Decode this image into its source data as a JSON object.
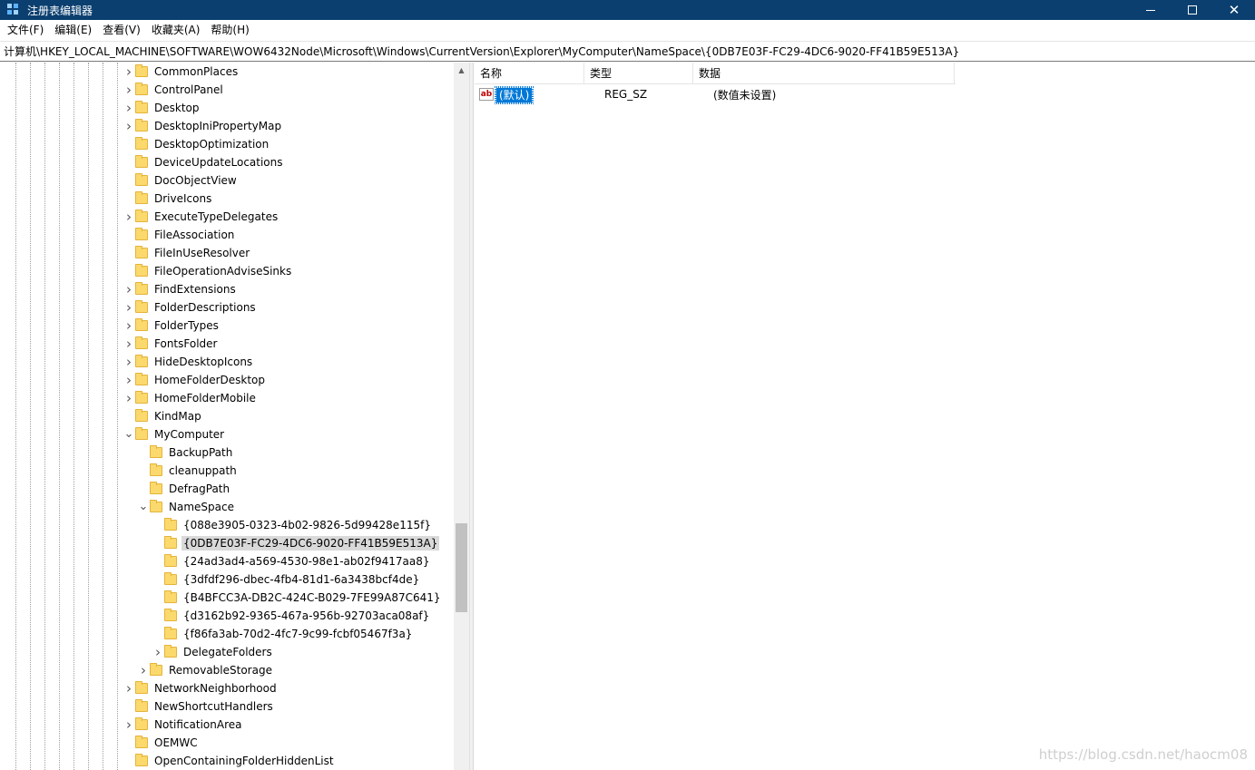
{
  "window": {
    "title": "注册表编辑器",
    "controls": {
      "minimize": "",
      "maximize": "",
      "close": "✕"
    }
  },
  "menu": [
    "文件(F)",
    "编辑(E)",
    "查看(V)",
    "收藏夹(A)",
    "帮助(H)"
  ],
  "address": "计算机\\HKEY_LOCAL_MACHINE\\SOFTWARE\\WOW6432Node\\Microsoft\\Windows\\CurrentVersion\\Explorer\\MyComputer\\NameSpace\\{0DB7E03F-FC29-4DC6-9020-FF41B59E513A}",
  "tree": [
    {
      "label": "CommonPlaces",
      "depth": 0,
      "expander": "collapsed"
    },
    {
      "label": "ControlPanel",
      "depth": 0,
      "expander": "collapsed"
    },
    {
      "label": "Desktop",
      "depth": 0,
      "expander": "collapsed"
    },
    {
      "label": "DesktopIniPropertyMap",
      "depth": 0,
      "expander": "collapsed"
    },
    {
      "label": "DesktopOptimization",
      "depth": 0,
      "expander": "none"
    },
    {
      "label": "DeviceUpdateLocations",
      "depth": 0,
      "expander": "none"
    },
    {
      "label": "DocObjectView",
      "depth": 0,
      "expander": "none"
    },
    {
      "label": "DriveIcons",
      "depth": 0,
      "expander": "none"
    },
    {
      "label": "ExecuteTypeDelegates",
      "depth": 0,
      "expander": "collapsed"
    },
    {
      "label": "FileAssociation",
      "depth": 0,
      "expander": "none"
    },
    {
      "label": "FileInUseResolver",
      "depth": 0,
      "expander": "none"
    },
    {
      "label": "FileOperationAdviseSinks",
      "depth": 0,
      "expander": "none"
    },
    {
      "label": "FindExtensions",
      "depth": 0,
      "expander": "collapsed"
    },
    {
      "label": "FolderDescriptions",
      "depth": 0,
      "expander": "collapsed"
    },
    {
      "label": "FolderTypes",
      "depth": 0,
      "expander": "collapsed"
    },
    {
      "label": "FontsFolder",
      "depth": 0,
      "expander": "collapsed"
    },
    {
      "label": "HideDesktopIcons",
      "depth": 0,
      "expander": "collapsed"
    },
    {
      "label": "HomeFolderDesktop",
      "depth": 0,
      "expander": "collapsed"
    },
    {
      "label": "HomeFolderMobile",
      "depth": 0,
      "expander": "collapsed"
    },
    {
      "label": "KindMap",
      "depth": 0,
      "expander": "none"
    },
    {
      "label": "MyComputer",
      "depth": 0,
      "expander": "expanded"
    },
    {
      "label": "BackupPath",
      "depth": 1,
      "expander": "none"
    },
    {
      "label": "cleanuppath",
      "depth": 1,
      "expander": "none"
    },
    {
      "label": "DefragPath",
      "depth": 1,
      "expander": "none"
    },
    {
      "label": "NameSpace",
      "depth": 1,
      "expander": "expanded"
    },
    {
      "label": "{088e3905-0323-4b02-9826-5d99428e115f}",
      "depth": 2,
      "expander": "none"
    },
    {
      "label": "{0DB7E03F-FC29-4DC6-9020-FF41B59E513A}",
      "depth": 2,
      "expander": "none",
      "selected": true
    },
    {
      "label": "{24ad3ad4-a569-4530-98e1-ab02f9417aa8}",
      "depth": 2,
      "expander": "none"
    },
    {
      "label": "{3dfdf296-dbec-4fb4-81d1-6a3438bcf4de}",
      "depth": 2,
      "expander": "none"
    },
    {
      "label": "{B4BFCC3A-DB2C-424C-B029-7FE99A87C641}",
      "depth": 2,
      "expander": "none"
    },
    {
      "label": "{d3162b92-9365-467a-956b-92703aca08af}",
      "depth": 2,
      "expander": "none"
    },
    {
      "label": "{f86fa3ab-70d2-4fc7-9c99-fcbf05467f3a}",
      "depth": 2,
      "expander": "none"
    },
    {
      "label": "DelegateFolders",
      "depth": 2,
      "expander": "collapsed"
    },
    {
      "label": "RemovableStorage",
      "depth": 1,
      "expander": "collapsed"
    },
    {
      "label": "NetworkNeighborhood",
      "depth": 0,
      "expander": "collapsed"
    },
    {
      "label": "NewShortcutHandlers",
      "depth": 0,
      "expander": "none"
    },
    {
      "label": "NotificationArea",
      "depth": 0,
      "expander": "collapsed"
    },
    {
      "label": "OEMWC",
      "depth": 0,
      "expander": "none"
    },
    {
      "label": "OpenContainingFolderHiddenList",
      "depth": 0,
      "expander": "none"
    }
  ],
  "values": {
    "columns": {
      "name": "名称",
      "type": "类型",
      "data": "数据"
    },
    "rows": [
      {
        "icon": "ab",
        "name": "(默认)",
        "type": "REG_SZ",
        "data": "(数值未设置)"
      }
    ]
  },
  "watermark": "https://blog.csdn.net/haocm08",
  "icons": {
    "app": "registry-editor-icon",
    "folder": "folder-icon",
    "string_value": "string-value-icon"
  },
  "colors": {
    "titlebar": "#0b3f6f",
    "selection": "#0078d7",
    "tree_selected": "#d9d9d9",
    "folder": "#fbd96d"
  }
}
